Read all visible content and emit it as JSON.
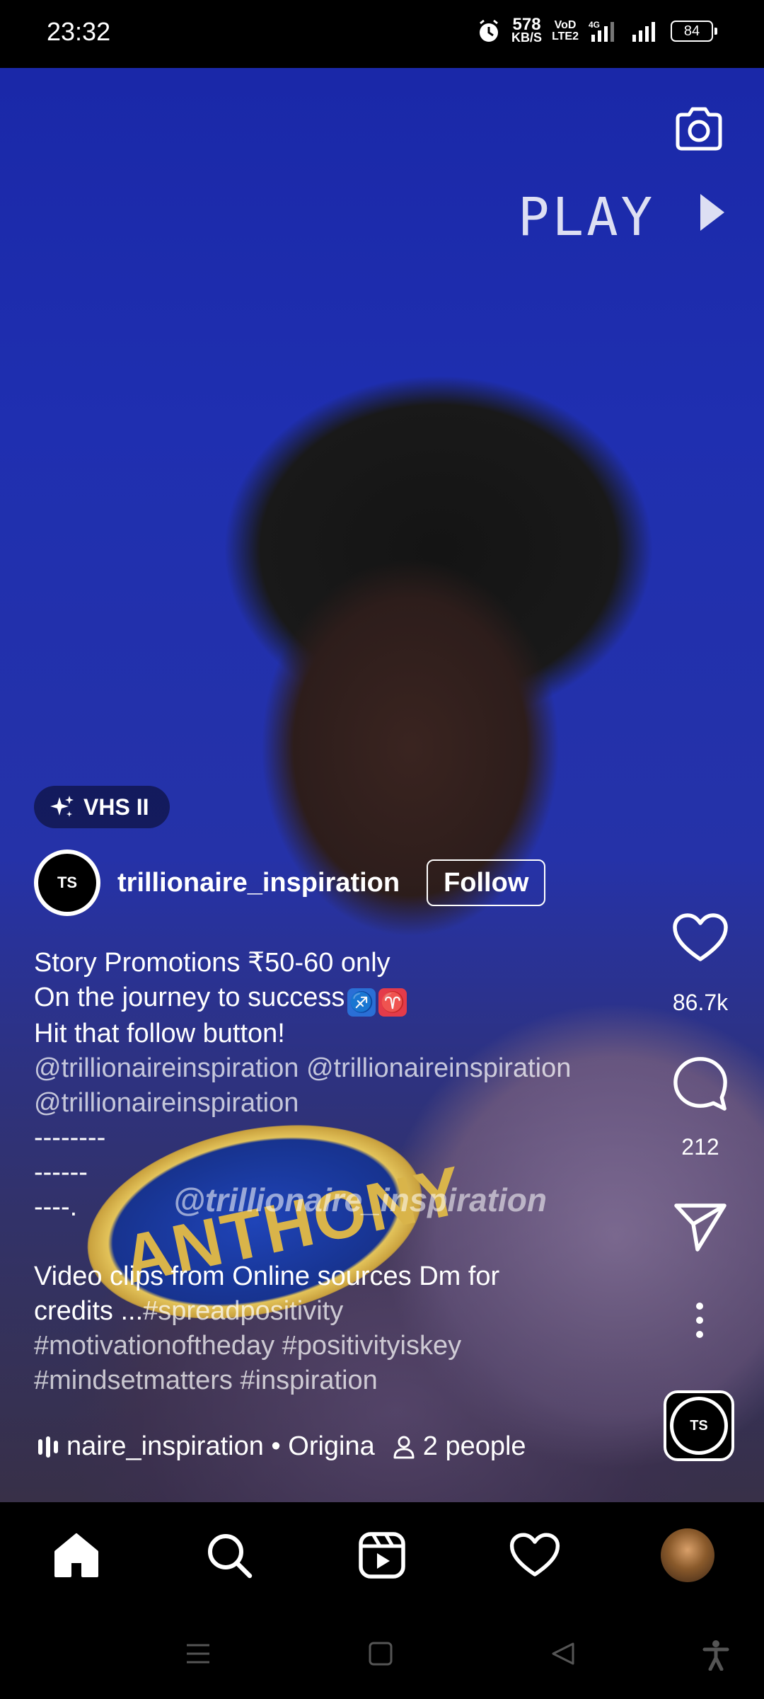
{
  "status_bar": {
    "time": "23:32",
    "net_speed_value": "578",
    "net_speed_unit": "KB/S",
    "carrier_top": "VoD",
    "carrier_bottom": "LTE2",
    "network": "4G",
    "battery": "84"
  },
  "video": {
    "overlay_play_text": "PLAY",
    "nametag_text": "ANTHONY",
    "watermark": "@trillionaire_inspiration"
  },
  "effect": {
    "label": "VHS II"
  },
  "author": {
    "avatar_text": "TS",
    "username": "trillionaire_inspiration",
    "follow_label": "Follow"
  },
  "caption": {
    "line1": "Story Promotions ₹50-60 only",
    "line2": " On the journey to success",
    "line2_emoji1": "♐",
    "line2_emoji2": "♈",
    "line3": " Hit that follow button!",
    "line4": "@trillionaireinspiration @trillionaireinspiration",
    "line5": "@trillionaireinspiration",
    "line6": "--------",
    "line7": "------",
    "line8": "----.",
    "line9": "Video clips from Online sources Dm for",
    "line10_plain": "credits ...",
    "line10_tag": "#spreadpositivity",
    "line11": "#motivationoftheday #positivityiskey",
    "line12": "#mindsetmatters #inspiration"
  },
  "audio": {
    "track": "naire_inspiration • Origina",
    "people": "2 people"
  },
  "actions": {
    "likes": "86.7k",
    "comments": "212"
  },
  "icons": {
    "camera": "camera-icon",
    "like": "heart-icon",
    "comment": "comment-icon",
    "share": "send-icon",
    "more": "more-vertical-icon",
    "home": "home-icon",
    "search": "search-icon",
    "reels": "reels-icon",
    "activity": "heart-icon",
    "profile": "avatar"
  }
}
